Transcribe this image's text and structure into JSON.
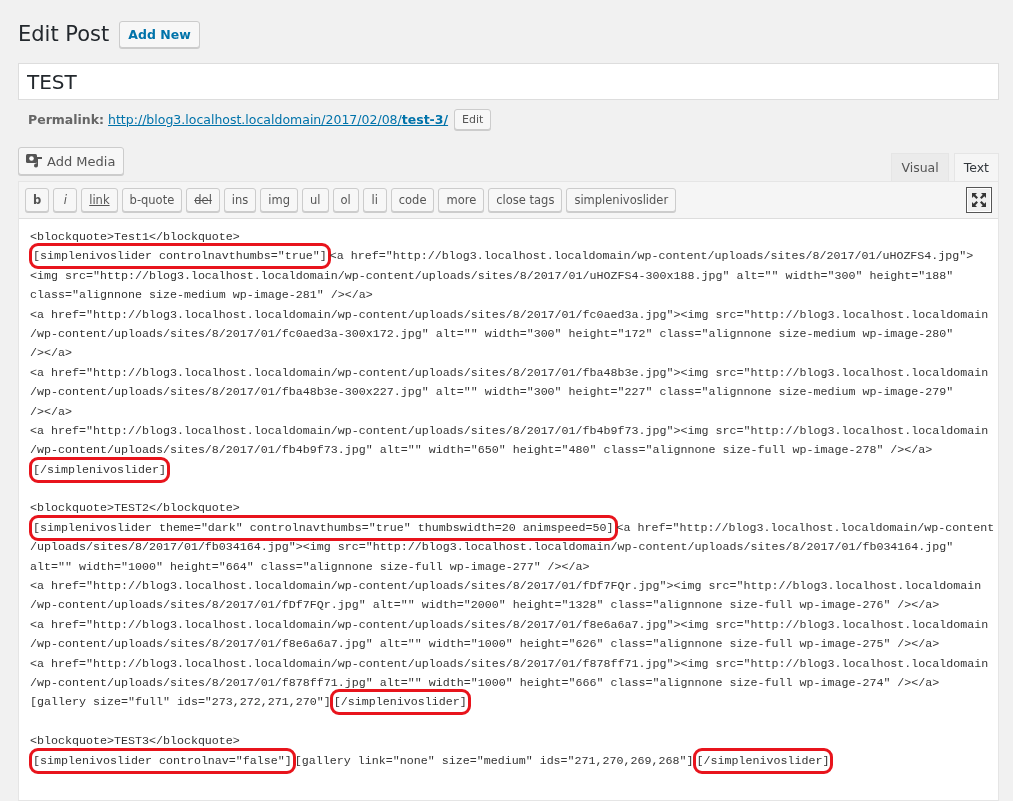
{
  "heading": {
    "title": "Edit Post",
    "add_new": "Add New"
  },
  "post_title": {
    "value": "TEST"
  },
  "permalink": {
    "label": "Permalink:",
    "url_start": "http://blog3.localhost.localdomain/2017/02/08/",
    "slug": "test-3/",
    "edit": "Edit"
  },
  "add_media": "Add Media",
  "tabs": [
    {
      "label": "Visual",
      "selected": false
    },
    {
      "label": "Text",
      "selected": true
    }
  ],
  "toolbar": [
    {
      "label": "b",
      "kind": "bold"
    },
    {
      "label": "i",
      "kind": "italic"
    },
    {
      "label": "link",
      "kind": "underline"
    },
    {
      "label": "b-quote",
      "kind": "plain"
    },
    {
      "label": "del",
      "kind": "strike"
    },
    {
      "label": "ins",
      "kind": "plain"
    },
    {
      "label": "img",
      "kind": "plain"
    },
    {
      "label": "ul",
      "kind": "plain"
    },
    {
      "label": "ol",
      "kind": "plain"
    },
    {
      "label": "li",
      "kind": "plain"
    },
    {
      "label": "code",
      "kind": "plain"
    },
    {
      "label": "more",
      "kind": "plain"
    },
    {
      "label": "close tags",
      "kind": "plain"
    },
    {
      "label": "simplenivoslider",
      "kind": "plain"
    }
  ],
  "fullscreen": {
    "on": true
  },
  "editor_blocks": [
    {
      "lines": [
        [
          {
            "text": "<blockquote>Test1</blockquote>",
            "highlighted": false
          }
        ],
        [
          {
            "text": "[simplenivoslider controlnavthumbs=\"true\"]",
            "highlighted": true
          },
          {
            "text": "<a href=\"http://blog3.localhost.localdomain/wp-content/uploads/sites/8/2017/01/uHOZFS4.jpg\">",
            "highlighted": false
          }
        ],
        [
          {
            "text": "<img src=\"http://blog3.localhost.localdomain/wp-content/uploads/sites/8/2017/01/uHOZFS4-300x188.jpg\" alt=\"\" width=\"300\" height=\"188\"",
            "highlighted": false
          }
        ],
        [
          {
            "text": "class=\"alignnone size-medium wp-image-281\" /></a>",
            "highlighted": false
          }
        ],
        [
          {
            "text": "<a href=\"http://blog3.localhost.localdomain/wp-content/uploads/sites/8/2017/01/fc0aed3a.jpg\"><img src=\"http://blog3.localhost.localdomain",
            "highlighted": false
          }
        ],
        [
          {
            "text": "/wp-content/uploads/sites/8/2017/01/fc0aed3a-300x172.jpg\" alt=\"\" width=\"300\" height=\"172\" class=\"alignnone size-medium wp-image-280\"",
            "highlighted": false
          }
        ],
        [
          {
            "text": "/></a>",
            "highlighted": false
          }
        ],
        [
          {
            "text": "<a href=\"http://blog3.localhost.localdomain/wp-content/uploads/sites/8/2017/01/fba48b3e.jpg\"><img src=\"http://blog3.localhost.localdomain",
            "highlighted": false
          }
        ],
        [
          {
            "text": "/wp-content/uploads/sites/8/2017/01/fba48b3e-300x227.jpg\" alt=\"\" width=\"300\" height=\"227\" class=\"alignnone size-medium wp-image-279\"",
            "highlighted": false
          }
        ],
        [
          {
            "text": "/></a>",
            "highlighted": false
          }
        ],
        [
          {
            "text": "<a href=\"http://blog3.localhost.localdomain/wp-content/uploads/sites/8/2017/01/fb4b9f73.jpg\"><img src=\"http://blog3.localhost.localdomain",
            "highlighted": false
          }
        ],
        [
          {
            "text": "/wp-content/uploads/sites/8/2017/01/fb4b9f73.jpg\" alt=\"\" width=\"650\" height=\"480\" class=\"alignnone size-full wp-image-278\" /></a>",
            "highlighted": false
          }
        ],
        [
          {
            "text": "[/simplenivoslider]",
            "highlighted": true
          }
        ]
      ]
    },
    {
      "lines": [
        [
          {
            "text": "<blockquote>TEST2</blockquote>",
            "highlighted": false
          }
        ],
        [
          {
            "text": "[simplenivoslider theme=\"dark\" controlnavthumbs=\"true\" thumbswidth=20 animspeed=50]",
            "highlighted": true
          },
          {
            "text": "<a href=\"http://blog3.localhost.localdomain/wp-content",
            "highlighted": false
          }
        ],
        [
          {
            "text": "/uploads/sites/8/2017/01/fb034164.jpg\"><img src=\"http://blog3.localhost.localdomain/wp-content/uploads/sites/8/2017/01/fb034164.jpg\"",
            "highlighted": false
          }
        ],
        [
          {
            "text": "alt=\"\" width=\"1000\" height=\"664\" class=\"alignnone size-full wp-image-277\" /></a>",
            "highlighted": false
          }
        ],
        [
          {
            "text": "<a href=\"http://blog3.localhost.localdomain/wp-content/uploads/sites/8/2017/01/fDf7FQr.jpg\"><img src=\"http://blog3.localhost.localdomain",
            "highlighted": false
          }
        ],
        [
          {
            "text": "/wp-content/uploads/sites/8/2017/01/fDf7FQr.jpg\" alt=\"\" width=\"2000\" height=\"1328\" class=\"alignnone size-full wp-image-276\" /></a>",
            "highlighted": false
          }
        ],
        [
          {
            "text": "<a href=\"http://blog3.localhost.localdomain/wp-content/uploads/sites/8/2017/01/f8e6a6a7.jpg\"><img src=\"http://blog3.localhost.localdomain",
            "highlighted": false
          }
        ],
        [
          {
            "text": "/wp-content/uploads/sites/8/2017/01/f8e6a6a7.jpg\" alt=\"\" width=\"1000\" height=\"626\" class=\"alignnone size-full wp-image-275\" /></a>",
            "highlighted": false
          }
        ],
        [
          {
            "text": "<a href=\"http://blog3.localhost.localdomain/wp-content/uploads/sites/8/2017/01/f878ff71.jpg\"><img src=\"http://blog3.localhost.localdomain",
            "highlighted": false
          }
        ],
        [
          {
            "text": "/wp-content/uploads/sites/8/2017/01/f878ff71.jpg\" alt=\"\" width=\"1000\" height=\"666\" class=\"alignnone size-full wp-image-274\" /></a>",
            "highlighted": false
          }
        ],
        [
          {
            "text": "[gallery size=\"full\" ids=\"273,272,271,270\"]",
            "highlighted": false
          },
          {
            "text": "[/simplenivoslider]",
            "highlighted": true
          }
        ]
      ]
    },
    {
      "lines": [
        [
          {
            "text": "<blockquote>TEST3</blockquote>",
            "highlighted": false
          }
        ],
        [
          {
            "text": "[simplenivoslider controlnav=\"false\"]",
            "highlighted": true
          },
          {
            "text": "[gallery link=\"none\" size=\"medium\" ids=\"271,270,269,268\"]",
            "highlighted": false
          },
          {
            "text": "[/simplenivoslider]",
            "highlighted": true
          }
        ]
      ]
    }
  ]
}
